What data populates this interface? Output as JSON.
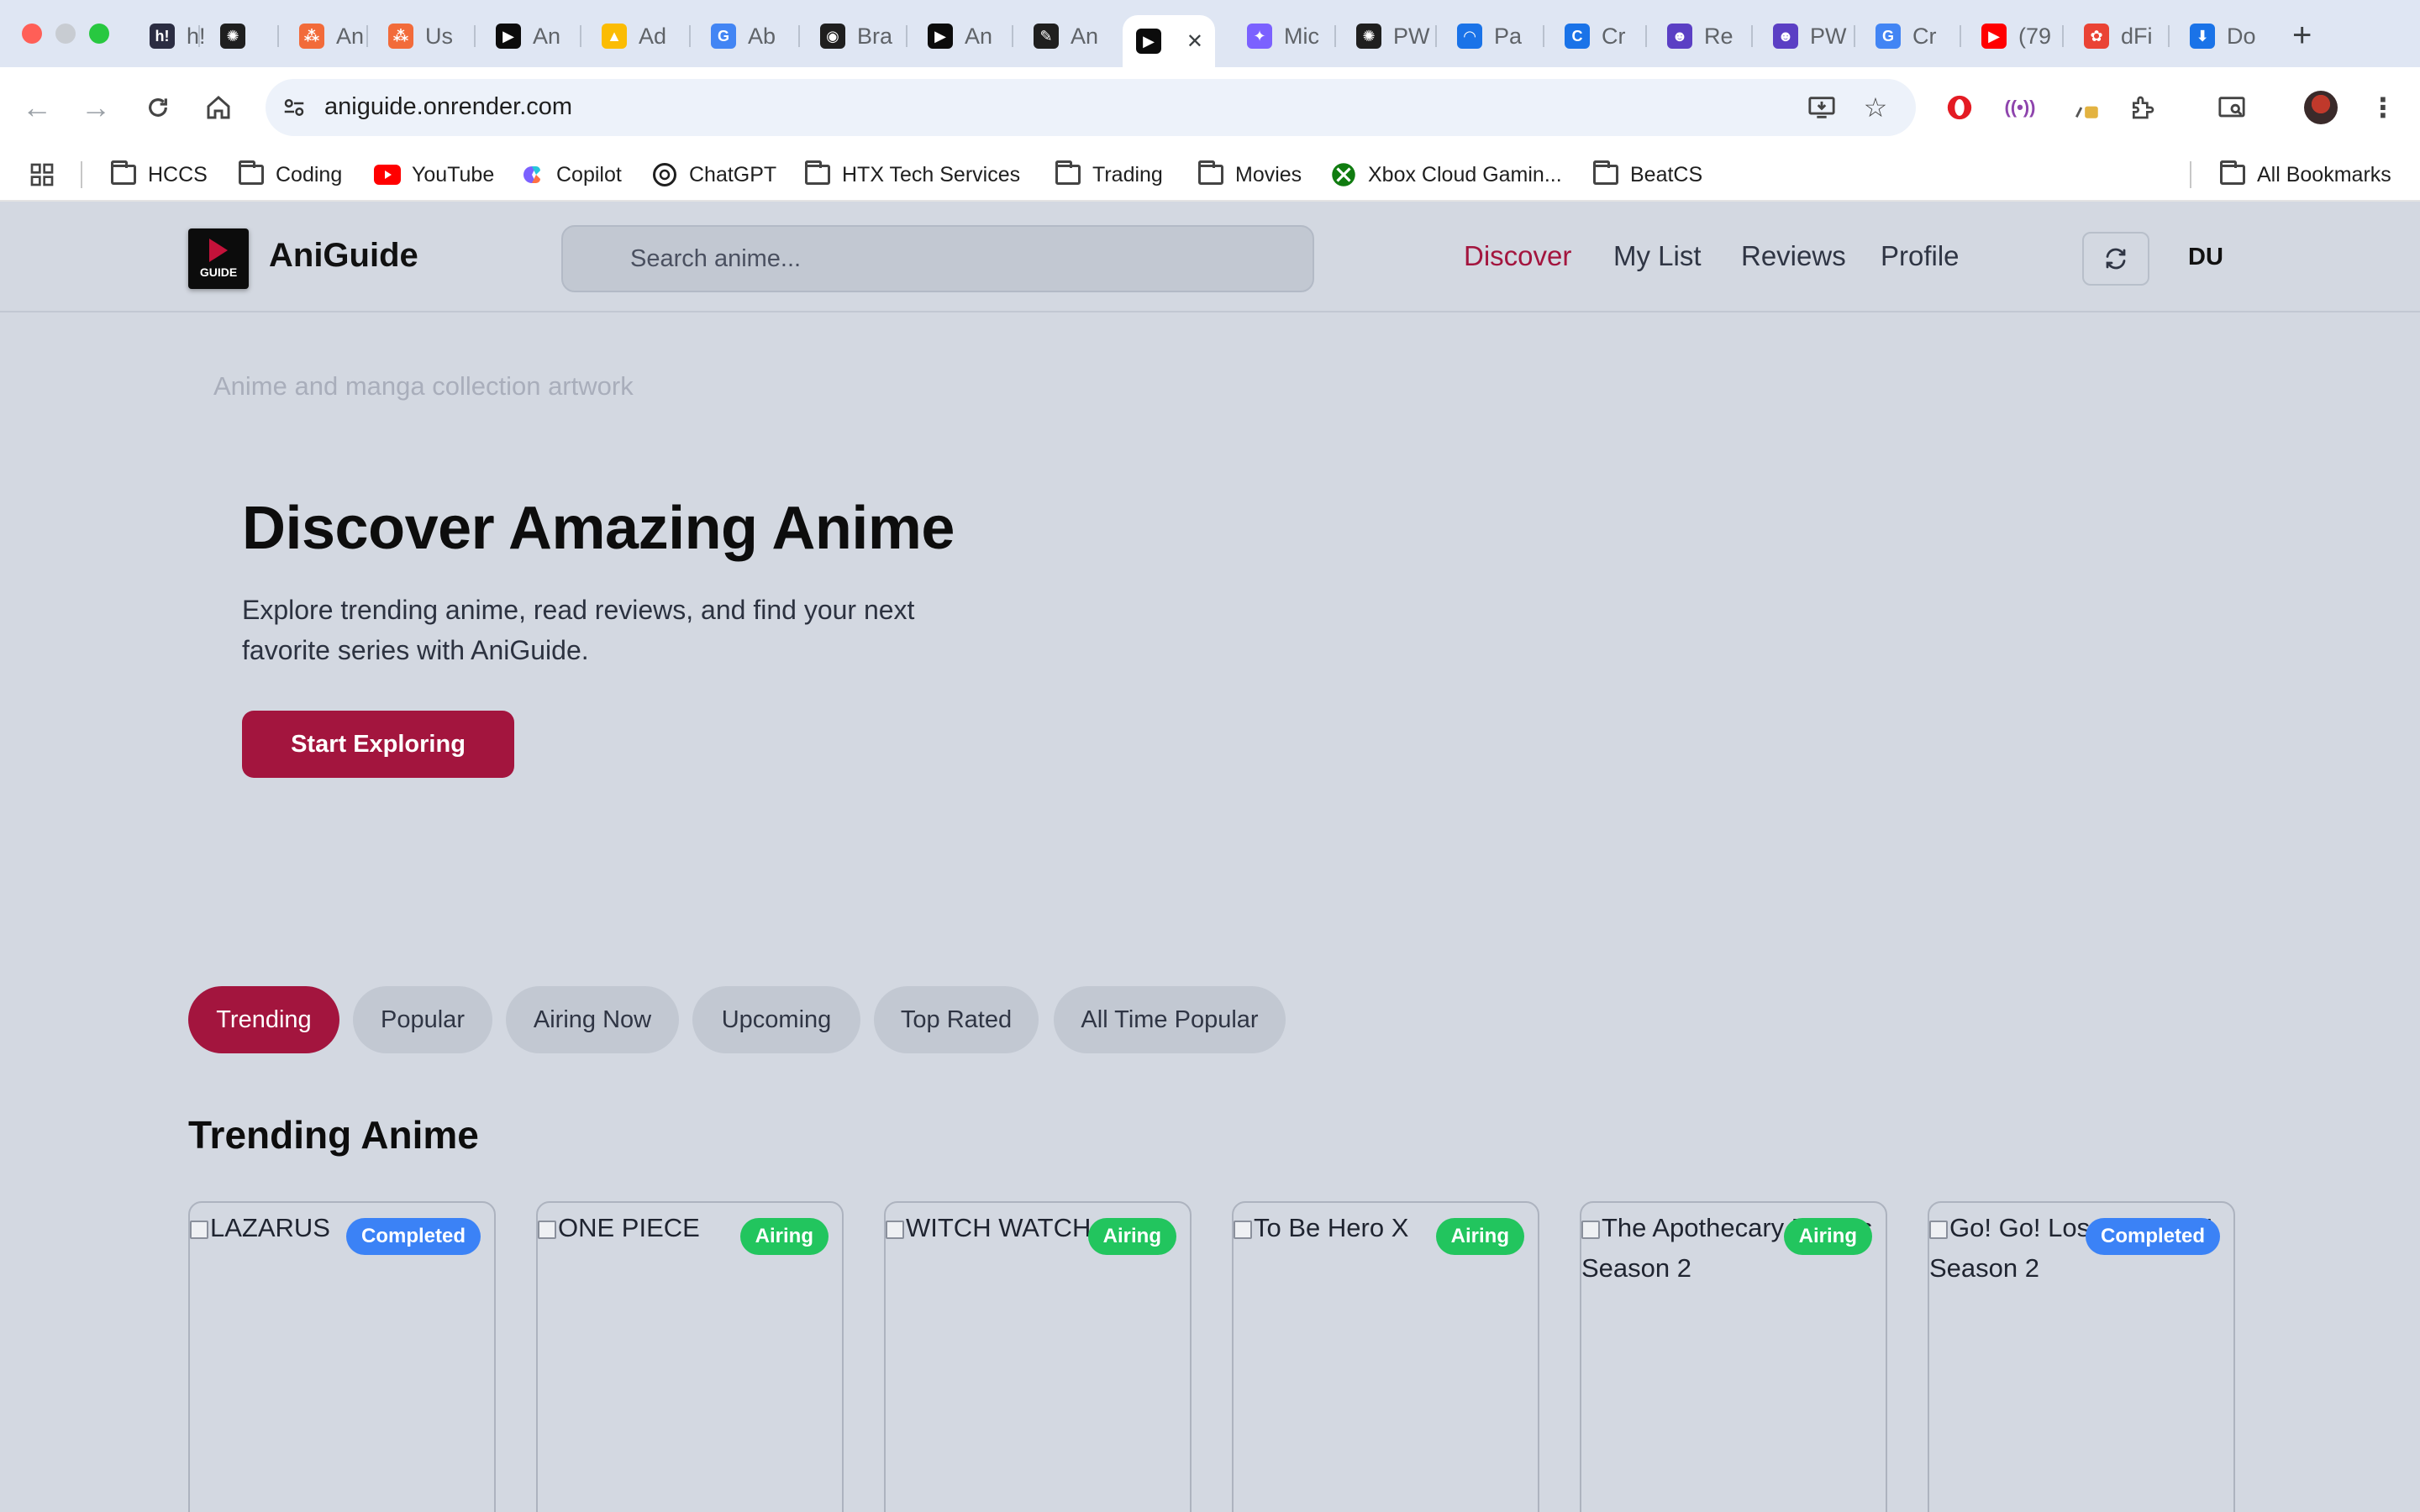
{
  "browser": {
    "tabs": [
      {
        "title": "h!",
        "favicon_color": "#2b2d42",
        "glyph": "h!"
      },
      {
        "title": "",
        "favicon_color": "#1f1f1f",
        "glyph": "✺"
      },
      {
        "title": "An",
        "favicon_color": "#f26b3a",
        "glyph": "⁂"
      },
      {
        "title": "Us",
        "favicon_color": "#f26b3a",
        "glyph": "⁂"
      },
      {
        "title": "An",
        "favicon_color": "#0c0c0c",
        "glyph": "▶"
      },
      {
        "title": "Ad",
        "favicon_color": "#fbbc04",
        "glyph": "▲"
      },
      {
        "title": "Ab",
        "favicon_color": "#4285f4",
        "glyph": "G"
      },
      {
        "title": "Bra",
        "favicon_color": "#1f1f1f",
        "glyph": "◉"
      },
      {
        "title": "An",
        "favicon_color": "#0c0c0c",
        "glyph": "▶"
      },
      {
        "title": "An",
        "favicon_color": "#1f1f1f",
        "glyph": "✎"
      },
      {
        "title": "",
        "favicon_color": "#0c0c0c",
        "glyph": "▶"
      },
      {
        "title": "Mic",
        "favicon_color": "#7b61ff",
        "glyph": "✦"
      },
      {
        "title": "PW",
        "favicon_color": "#1f1f1f",
        "glyph": "✺"
      },
      {
        "title": "Pa",
        "favicon_color": "#1a73e8",
        "glyph": "◠"
      },
      {
        "title": "Cr",
        "favicon_color": "#1a73e8",
        "glyph": "C"
      },
      {
        "title": "Re",
        "favicon_color": "#5b3fc4",
        "glyph": "☻"
      },
      {
        "title": "PW",
        "favicon_color": "#5b3fc4",
        "glyph": "☻"
      },
      {
        "title": "Cr",
        "favicon_color": "#4285f4",
        "glyph": "G"
      },
      {
        "title": "(79",
        "favicon_color": "#ff0000",
        "glyph": "▶"
      },
      {
        "title": "dFi",
        "favicon_color": "#ea4335",
        "glyph": "✿"
      },
      {
        "title": "Do",
        "favicon_color": "#1a73e8",
        "glyph": "⬇"
      }
    ],
    "url": "aniguide.onrender.com",
    "bookmarks": [
      {
        "label": "HCCS",
        "icon": "folder-icon"
      },
      {
        "label": "Coding",
        "icon": "folder-icon"
      },
      {
        "label": "YouTube",
        "icon": "youtube-icon"
      },
      {
        "label": "Copilot",
        "icon": "copilot-icon"
      },
      {
        "label": "ChatGPT",
        "icon": "chatgpt-icon"
      },
      {
        "label": "HTX Tech Services",
        "icon": "folder-icon"
      },
      {
        "label": "Trading",
        "icon": "folder-icon"
      },
      {
        "label": "Movies",
        "icon": "folder-icon"
      },
      {
        "label": "Xbox Cloud Gamin...",
        "icon": "xbox-icon"
      },
      {
        "label": "BeatCS",
        "icon": "folder-icon"
      }
    ],
    "all_bookmarks": "All Bookmarks"
  },
  "site": {
    "logo_text": "GUIDE",
    "brand": "AniGuide",
    "search_placeholder": "Search anime...",
    "nav": [
      {
        "label": "Discover",
        "active": true
      },
      {
        "label": "My List",
        "active": false
      },
      {
        "label": "Reviews",
        "active": false
      },
      {
        "label": "Profile",
        "active": false
      }
    ],
    "user_initials": "DU",
    "accent": "#a3153e"
  },
  "hero": {
    "image_alt": "Anime and manga collection artwork",
    "title": "Discover Amazing Anime",
    "subtitle": "Explore trending anime, read reviews, and find your next favorite series with AniGuide.",
    "cta": "Start Exploring"
  },
  "filters": [
    {
      "label": "Trending",
      "active": true
    },
    {
      "label": "Popular",
      "active": false
    },
    {
      "label": "Airing Now",
      "active": false
    },
    {
      "label": "Upcoming",
      "active": false
    },
    {
      "label": "Top Rated",
      "active": false
    },
    {
      "label": "All Time Popular",
      "active": false
    }
  ],
  "section_title": "Trending Anime",
  "cards": [
    {
      "title": "LAZARUS",
      "status": "Completed",
      "status_color": "#3b82f6"
    },
    {
      "title": "ONE PIECE",
      "status": "Airing",
      "status_color": "#22c55e"
    },
    {
      "title": "WITCH WATCH",
      "status": "Airing",
      "status_color": "#22c55e"
    },
    {
      "title": "To Be Hero X",
      "status": "Airing",
      "status_color": "#22c55e"
    },
    {
      "title": "The Apothecary Diaries Season 2",
      "status": "Airing",
      "status_color": "#22c55e"
    },
    {
      "title": "Go! Go! Loser Ranger! Season 2",
      "status": "Completed",
      "status_color": "#3b82f6"
    }
  ]
}
